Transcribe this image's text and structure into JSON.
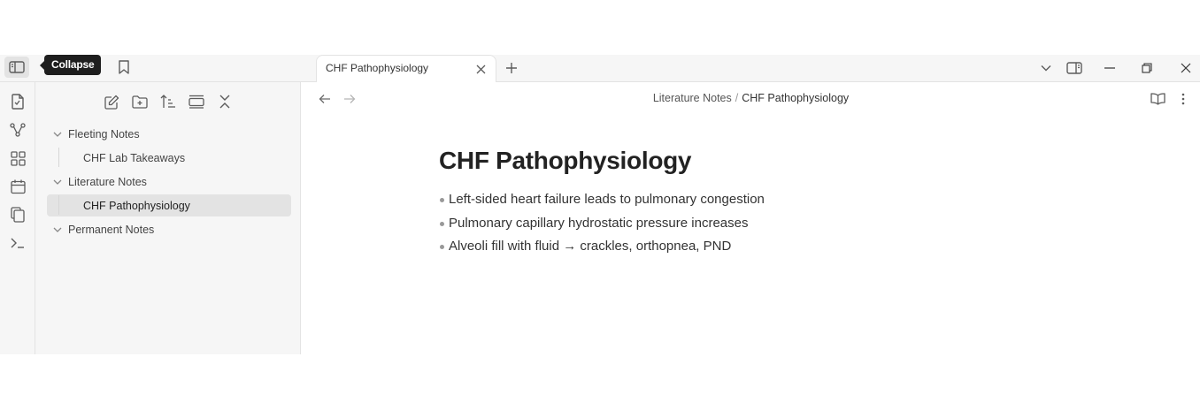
{
  "tooltip": {
    "label": "Collapse"
  },
  "tabs": [
    {
      "title": "CHF Pathophysiology"
    }
  ],
  "ribbon": {
    "items": [
      "file-icon",
      "graph-icon",
      "grid-icon",
      "calendar-icon",
      "copy-icon",
      "terminal-icon"
    ]
  },
  "file_toolbar": {
    "items": [
      "new-note-icon",
      "new-folder-icon",
      "sort-icon",
      "collapse-view-icon",
      "collapse-all-icon"
    ]
  },
  "file_tree": {
    "folders": [
      {
        "label": "Fleeting Notes",
        "children": [
          "CHF Lab Takeaways"
        ]
      },
      {
        "label": "Literature Notes",
        "children": [
          "CHF Pathophysiology"
        ]
      },
      {
        "label": "Permanent Notes",
        "children": []
      }
    ],
    "active_file": "CHF Pathophysiology"
  },
  "breadcrumb": {
    "parent": "Literature Notes",
    "separator": "/",
    "current": "CHF Pathophysiology"
  },
  "document": {
    "title": "CHF Pathophysiology",
    "bullets": [
      "Left-sided heart failure leads to pulmonary congestion",
      "Pulmonary capillary hydrostatic pressure increases",
      "Alveoli fill with fluid → crackles, orthopnea, PND"
    ]
  },
  "colors": {
    "panel_bg": "#f6f6f6",
    "active_row": "#e3e3e3",
    "tooltip_bg": "#1e1e1e"
  }
}
